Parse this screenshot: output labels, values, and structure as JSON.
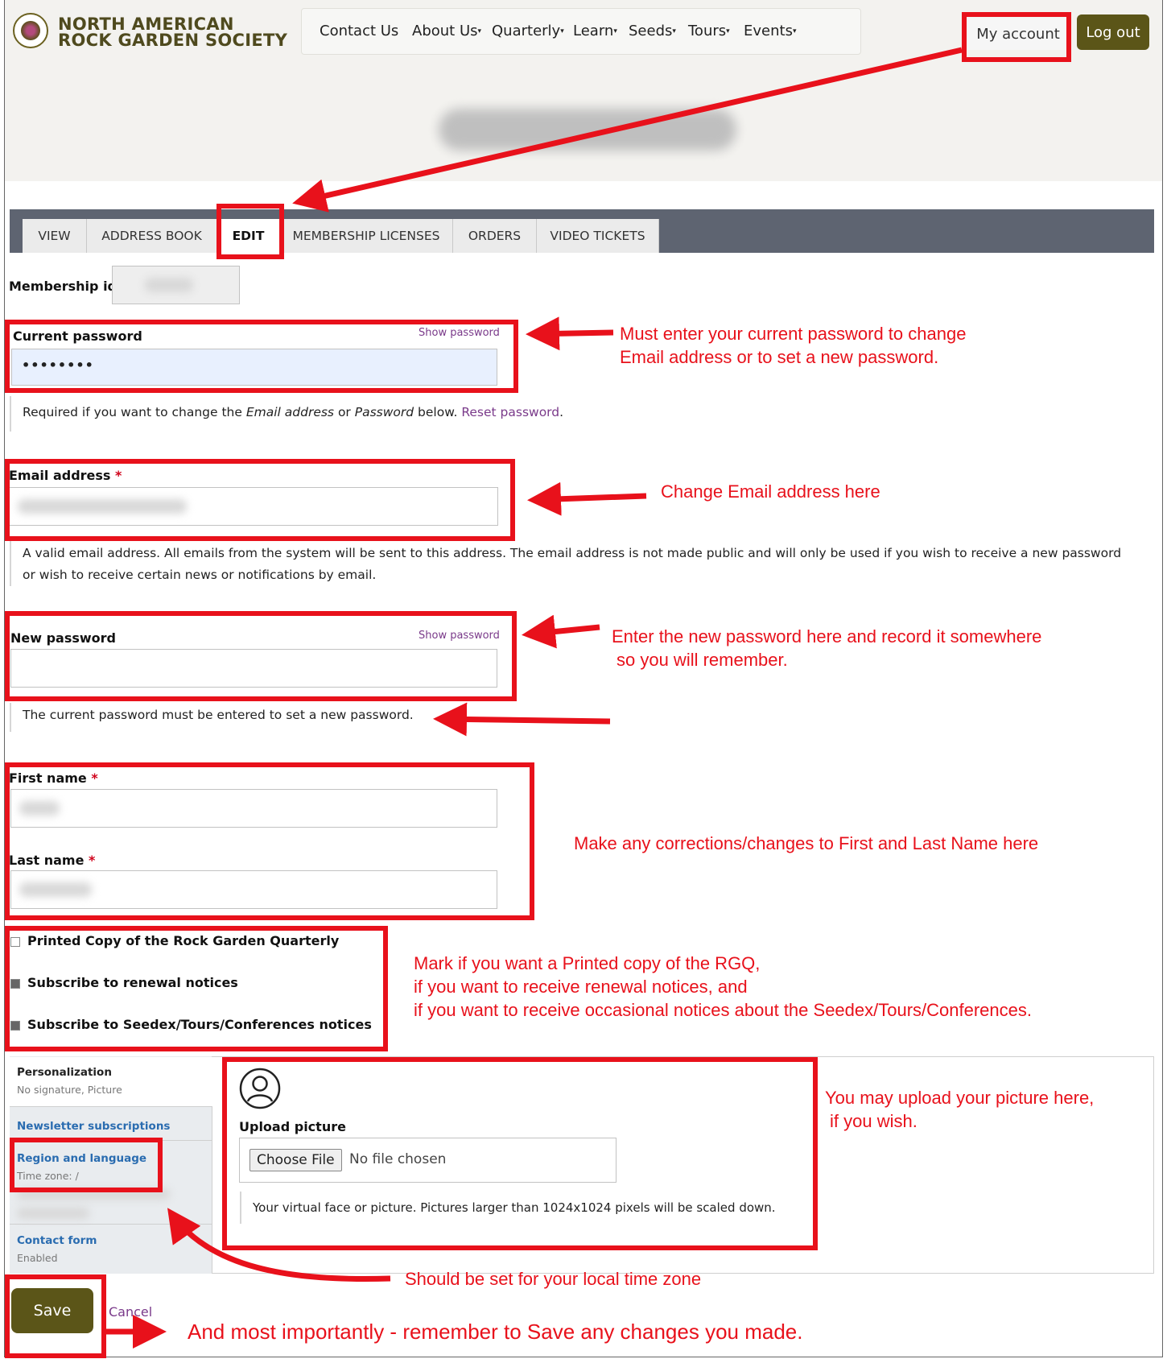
{
  "site": {
    "name_line1": "NORTH AMERICAN",
    "name_line2": "ROCK GARDEN SOCIETY"
  },
  "nav": {
    "items": [
      "Contact Us",
      "About Us",
      "Quarterly",
      "Learn",
      "Seeds",
      "Tours",
      "Events"
    ]
  },
  "account": {
    "my_account": "My account",
    "logout": "Log out"
  },
  "tabs": [
    "VIEW",
    "ADDRESS BOOK",
    "EDIT",
    "MEMBERSHIP LICENSES",
    "ORDERS",
    "VIDEO TICKETS"
  ],
  "form": {
    "membership_id_label": "Membership id",
    "current_password_label": "Current password",
    "show_password": "Show password",
    "current_password_value": "••••••••",
    "current_password_desc_pre": "Required if you want to change the ",
    "current_password_desc_em1": "Email address",
    "current_password_desc_mid": " or ",
    "current_password_desc_em2": "Password",
    "current_password_desc_post": " below. ",
    "reset_password": "Reset password",
    "current_password_desc_end": ".",
    "email_label": "Email address",
    "required_mark": "*",
    "email_desc": "A valid email address. All emails from the system will be sent to this address. The email address is not made public and will only be used if you wish to receive a new password or wish to receive certain news or notifications by email.",
    "new_password_label": "New password",
    "new_password_desc": "The current password must be entered to set a new password.",
    "first_name_label": "First name",
    "last_name_label": "Last name",
    "checkboxes": [
      {
        "label": "Printed Copy of the Rock Garden Quarterly",
        "checked": false
      },
      {
        "label": "Subscribe to renewal notices",
        "checked": true
      },
      {
        "label": "Subscribe to Seedex/Tours/Conferences notices",
        "checked": true
      }
    ],
    "vertical_tabs": [
      {
        "title": "Personalization",
        "summary": "No signature, Picture"
      },
      {
        "title": "Newsletter subscriptions",
        "summary": ""
      },
      {
        "title": "Region and language",
        "summary": "Time zone: /"
      },
      {
        "title": "Contact form",
        "summary": "Enabled"
      }
    ],
    "upload_label": "Upload picture",
    "choose_file": "Choose File",
    "no_file": "No file chosen",
    "upload_desc": "Your virtual face or picture. Pictures larger than 1024x1024 pixels will be scaled down.",
    "save": "Save",
    "cancel": "Cancel"
  },
  "annotations": {
    "current_pw_1": "Must enter your current password to change",
    "current_pw_2": "Email address or to set a new password.",
    "email": "Change Email address here",
    "new_pw_1": "Enter the new password here and record it somewhere",
    "new_pw_2": "so you will remember.",
    "names": "Make any corrections/changes to First and Last Name here",
    "checks_1": "Mark if you want a Printed copy of the RGQ,",
    "checks_2": "if you want to receive renewal notices, and",
    "checks_3": "if you want to receive occasional notices about the Seedex/Tours/Conferences.",
    "picture_1": "You may upload your picture here,",
    "picture_2": "if you wish.",
    "timezone": "Should be set for your local time zone",
    "save": "And most importantly - remember to Save any changes you made."
  },
  "colors": {
    "annotation_red": "#e8111b",
    "brand_olive": "#5b5518",
    "tabbar": "#5e6471",
    "link_purple": "#7a3a8a",
    "link_blue": "#2a6cb0"
  }
}
